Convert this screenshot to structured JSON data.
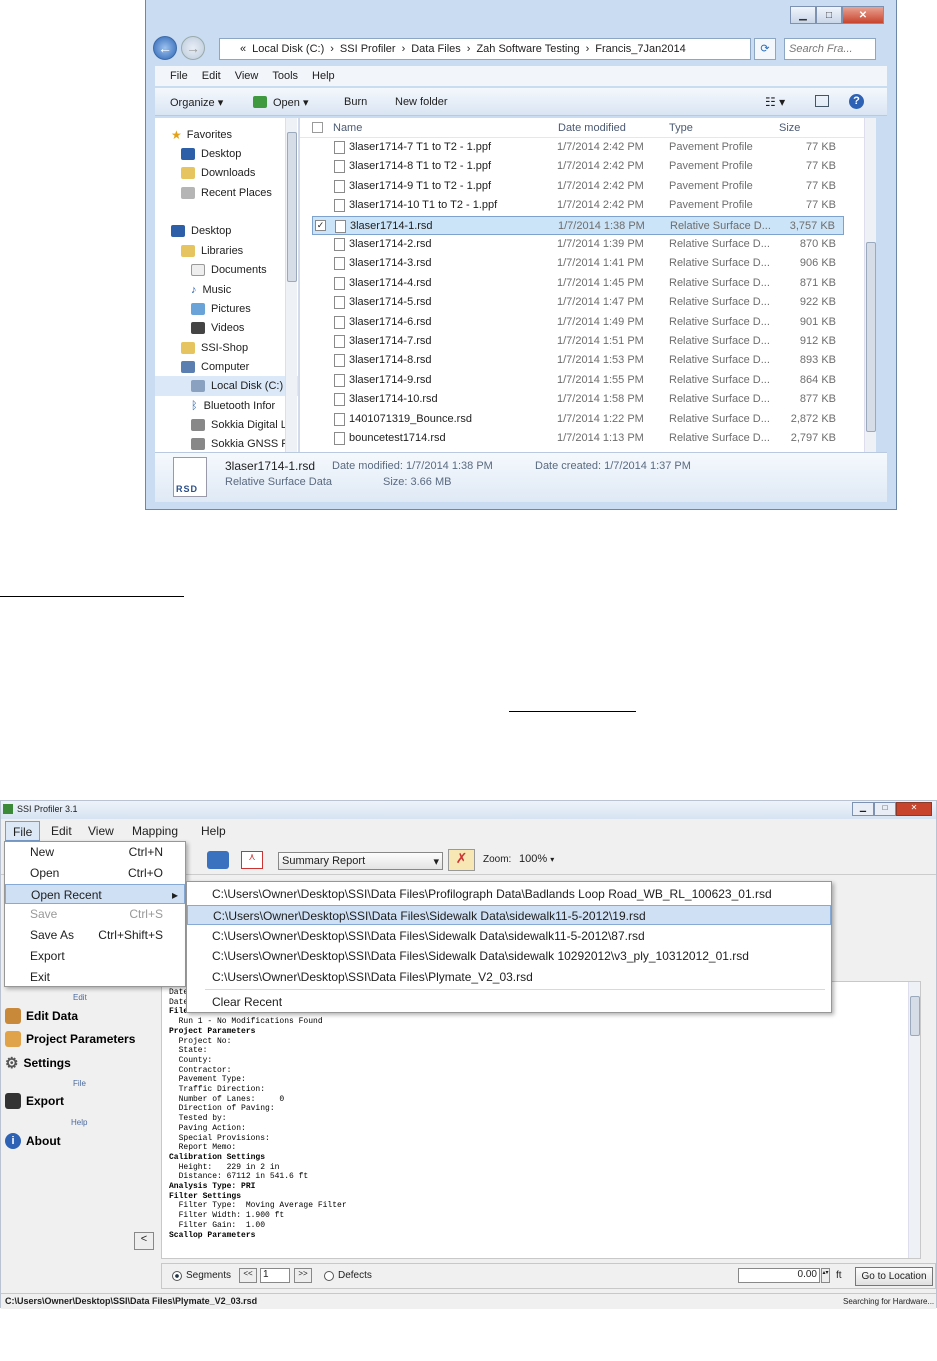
{
  "explorer": {
    "address": [
      "«",
      "Local Disk (C:)",
      "›",
      "SSI Profiler",
      "›",
      "Data Files",
      "›",
      "Zah Software Testing",
      "›",
      "Francis_7Jan2014"
    ],
    "search_placeholder": "Search Fra...",
    "menu": [
      "File",
      "Edit",
      "View",
      "Tools",
      "Help"
    ],
    "commands": [
      "Organize ▾",
      "Open ▾",
      "Burn",
      "New folder"
    ],
    "nav": {
      "favorites": "Favorites",
      "desktop": "Desktop",
      "downloads": "Downloads",
      "recent": "Recent Places",
      "desktop2": "Desktop",
      "libraries": "Libraries",
      "documents": "Documents",
      "music": "Music",
      "pictures": "Pictures",
      "videos": "Videos",
      "ssishop": "SSI-Shop",
      "computer": "Computer",
      "localdisk": "Local Disk (C:)",
      "bluetooth": "Bluetooth Infor",
      "sokkia1": "Sokkia Digital L",
      "sokkia2": "Sokkia GNSS Re"
    },
    "columns": {
      "name": "Name",
      "date": "Date modified",
      "type": "Type",
      "size": "Size"
    },
    "files": [
      {
        "name": "3laser1714-7 T1 to T2 - 1.ppf",
        "date": "1/7/2014 2:42 PM",
        "type": "Pavement Profile",
        "size": "77 KB"
      },
      {
        "name": "3laser1714-8 T1 to T2 - 1.ppf",
        "date": "1/7/2014 2:42 PM",
        "type": "Pavement Profile",
        "size": "77 KB"
      },
      {
        "name": "3laser1714-9 T1 to T2 - 1.ppf",
        "date": "1/7/2014 2:42 PM",
        "type": "Pavement Profile",
        "size": "77 KB"
      },
      {
        "name": "3laser1714-10 T1 to T2 - 1.ppf",
        "date": "1/7/2014 2:42 PM",
        "type": "Pavement Profile",
        "size": "77 KB"
      },
      {
        "name": "3laser1714-1.rsd",
        "date": "1/7/2014 1:38 PM",
        "type": "Relative Surface D...",
        "size": "3,757 KB"
      },
      {
        "name": "3laser1714-2.rsd",
        "date": "1/7/2014 1:39 PM",
        "type": "Relative Surface D...",
        "size": "870 KB"
      },
      {
        "name": "3laser1714-3.rsd",
        "date": "1/7/2014 1:41 PM",
        "type": "Relative Surface D...",
        "size": "906 KB"
      },
      {
        "name": "3laser1714-4.rsd",
        "date": "1/7/2014 1:45 PM",
        "type": "Relative Surface D...",
        "size": "871 KB"
      },
      {
        "name": "3laser1714-5.rsd",
        "date": "1/7/2014 1:47 PM",
        "type": "Relative Surface D...",
        "size": "922 KB"
      },
      {
        "name": "3laser1714-6.rsd",
        "date": "1/7/2014 1:49 PM",
        "type": "Relative Surface D...",
        "size": "901 KB"
      },
      {
        "name": "3laser1714-7.rsd",
        "date": "1/7/2014 1:51 PM",
        "type": "Relative Surface D...",
        "size": "912 KB"
      },
      {
        "name": "3laser1714-8.rsd",
        "date": "1/7/2014 1:53 PM",
        "type": "Relative Surface D...",
        "size": "893 KB"
      },
      {
        "name": "3laser1714-9.rsd",
        "date": "1/7/2014 1:55 PM",
        "type": "Relative Surface D...",
        "size": "864 KB"
      },
      {
        "name": "3laser1714-10.rsd",
        "date": "1/7/2014 1:58 PM",
        "type": "Relative Surface D...",
        "size": "877 KB"
      },
      {
        "name": "1401071319_Bounce.rsd",
        "date": "1/7/2014 1:22 PM",
        "type": "Relative Surface D...",
        "size": "2,872 KB"
      },
      {
        "name": "bouncetest1714.rsd",
        "date": "1/7/2014 1:13 PM",
        "type": "Relative Surface D...",
        "size": "2,797 KB"
      }
    ],
    "selected_index": 4,
    "details": {
      "icon_text": "RSD",
      "name": "3laser1714-1.rsd",
      "type": "Relative Surface Data",
      "modified": "Date modified: 1/7/2014 1:38 PM",
      "created": "Date created: 1/7/2014 1:37 PM",
      "size": "Size: 3.66 MB"
    }
  },
  "profiler": {
    "title": "SSI Profiler 3.1",
    "menu": [
      "File",
      "Edit",
      "View",
      "Mapping",
      "Help"
    ],
    "report_select": "Summary Report",
    "zoom_label": "Zoom:",
    "zoom_value": "100%",
    "file_menu": [
      {
        "label": "New",
        "shortcut": "Ctrl+N"
      },
      {
        "label": "Open",
        "shortcut": "Ctrl+O"
      },
      {
        "label": "Open Recent",
        "shortcut": "▸"
      },
      {
        "label": "Save",
        "shortcut": "Ctrl+S"
      },
      {
        "label": "Save As",
        "shortcut": "Ctrl+Shift+S"
      },
      {
        "label": "Export",
        "shortcut": ""
      },
      {
        "label": "Exit",
        "shortcut": ""
      }
    ],
    "recent": [
      "C:\\Users\\Owner\\Desktop\\SSI\\Data Files\\Profilograph Data\\Badlands Loop Road_WB_RL_100623_01.rsd",
      "C:\\Users\\Owner\\Desktop\\SSI\\Data Files\\Sidewalk Data\\sidewalk11-5-2012\\19.rsd",
      "C:\\Users\\Owner\\Desktop\\SSI\\Data Files\\Sidewalk Data\\sidewalk11-5-2012\\87.rsd",
      "C:\\Users\\Owner\\Desktop\\SSI\\Data Files\\Sidewalk Data\\sidewalk 10292012\\v3_ply_10312012_01.rsd",
      "C:\\Users\\Owner\\Desktop\\SSI\\Data Files\\Plymate_V2_03.rsd"
    ],
    "clear_recent": "Clear Recent",
    "sidebar": {
      "edit_cap": "Edit",
      "edit_data": "Edit Data",
      "project_params": "Project Parameters",
      "settings": "Settings",
      "file_cap": "File",
      "export": "Export",
      "help_cap": "Help",
      "about": "About",
      "collapse": "<"
    },
    "report_lines": [
      "Date",
      "Date",
      "",
      "File Modifications",
      "  Run 1 - No Modifications Found",
      "",
      "Project Parameters",
      "  Project No:",
      "  State:",
      "  County:",
      "  Contractor:",
      "  Pavement Type:",
      "  Traffic Direction:",
      "  Number of Lanes:     0",
      "  Direction of Paving:",
      "  Tested by:",
      "  Paving Action:",
      "  Special Provisions:",
      "  Report Memo:",
      "Calibration Settings",
      "  Height:   229 in 2 in",
      "  Distance: 67112 in 541.6 ft",
      "Analysis Type: PRI",
      "Filter Settings",
      "  Filter Type:  Moving Average Filter",
      "  Filter Width: 1.900 ft",
      "  Filter Gain:  1.00",
      "Scallop Parameters"
    ],
    "bottom": {
      "segments": "Segments",
      "prev": "<<",
      "page": "1",
      "next": ">>",
      "defects": "Defects",
      "distance": "0.00",
      "unit": "ft",
      "goto": "Go to Location"
    },
    "status": {
      "path": "C:\\Users\\Owner\\Desktop\\SSI\\Data Files\\Plymate_V2_03.rsd",
      "right": "Searching for Hardware..."
    }
  }
}
